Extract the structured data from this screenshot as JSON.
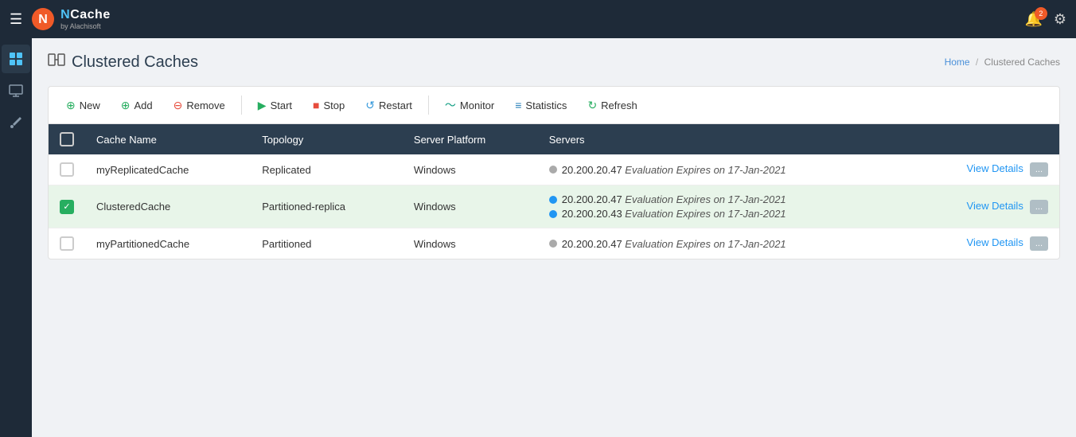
{
  "app": {
    "title": "NCache",
    "subtitle": "by Alachisoft",
    "notification_count": "2"
  },
  "breadcrumb": {
    "home": "Home",
    "separator": "/",
    "current": "Clustered Caches"
  },
  "page": {
    "title": "Clustered Caches"
  },
  "toolbar": {
    "new_label": "New",
    "add_label": "Add",
    "remove_label": "Remove",
    "start_label": "Start",
    "stop_label": "Stop",
    "restart_label": "Restart",
    "monitor_label": "Monitor",
    "statistics_label": "Statistics",
    "refresh_label": "Refresh"
  },
  "table": {
    "headers": [
      "Cache Name",
      "Topology",
      "Server Platform",
      "Servers"
    ],
    "rows": [
      {
        "id": "row1",
        "checked": false,
        "cache_name": "myReplicatedCache",
        "topology": "Replicated",
        "platform": "Windows",
        "servers": [
          {
            "status": "gray",
            "ip": "20.200.20.47",
            "eval_text": "Evaluation Expires on 17-Jan-2021"
          }
        ]
      },
      {
        "id": "row2",
        "checked": true,
        "cache_name": "ClusteredCache",
        "topology": "Partitioned-replica",
        "platform": "Windows",
        "servers": [
          {
            "status": "blue",
            "ip": "20.200.20.47",
            "eval_text": "Evaluation Expires on 17-Jan-2021"
          },
          {
            "status": "blue",
            "ip": "20.200.20.43",
            "eval_text": "Evaluation Expires on 17-Jan-2021"
          }
        ]
      },
      {
        "id": "row3",
        "checked": false,
        "cache_name": "myPartitionedCache",
        "topology": "Partitioned",
        "platform": "Windows",
        "servers": [
          {
            "status": "gray",
            "ip": "20.200.20.47",
            "eval_text": "Evaluation Expires on 17-Jan-2021"
          }
        ]
      }
    ],
    "view_details_label": "View Details",
    "more_label": "..."
  },
  "sidebar": {
    "items": [
      {
        "name": "grid-icon",
        "label": "Dashboard",
        "active": true,
        "symbol": "⊞"
      },
      {
        "name": "monitor-icon",
        "label": "Monitor",
        "active": false,
        "symbol": "🖥"
      },
      {
        "name": "tools-icon",
        "label": "Tools",
        "active": false,
        "symbol": "🔧"
      }
    ]
  }
}
